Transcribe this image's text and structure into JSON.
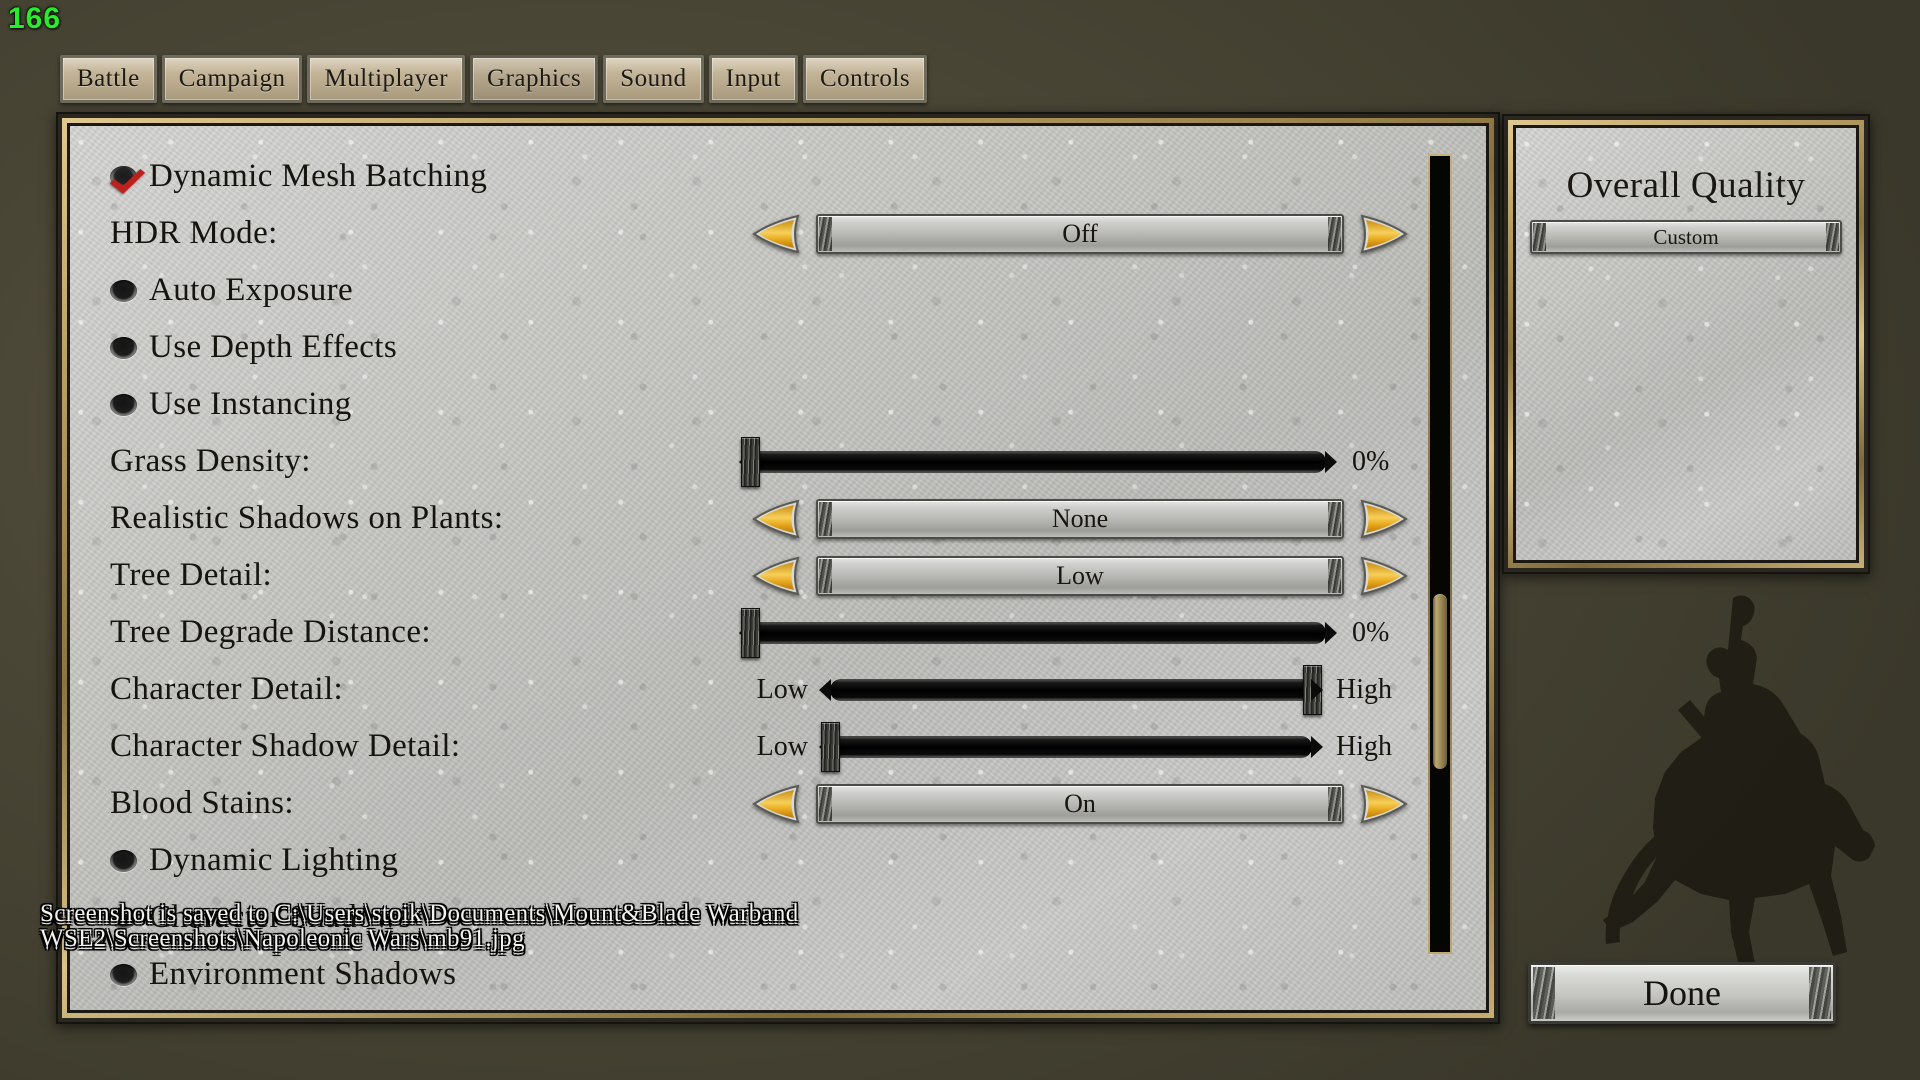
{
  "hud": {
    "fps": "166"
  },
  "tabs": [
    {
      "label": "Battle",
      "active": false
    },
    {
      "label": "Campaign",
      "active": false
    },
    {
      "label": "Multiplayer",
      "active": false
    },
    {
      "label": "Graphics",
      "active": true
    },
    {
      "label": "Sound",
      "active": false
    },
    {
      "label": "Input",
      "active": false
    },
    {
      "label": "Controls",
      "active": false
    }
  ],
  "options": [
    {
      "label": "Dynamic Mesh Batching",
      "type": "checkbox",
      "state": "checked"
    },
    {
      "label": "HDR Mode:",
      "type": "selector",
      "value": "Off"
    },
    {
      "label": "Auto Exposure",
      "type": "checkbox",
      "state": "dot"
    },
    {
      "label": "Use Depth Effects",
      "type": "checkbox",
      "state": "dot"
    },
    {
      "label": "Use Instancing",
      "type": "checkbox",
      "state": "dot"
    },
    {
      "label": "Grass Density:",
      "type": "slider",
      "percent": "0%",
      "fill": 0
    },
    {
      "label": "Realistic Shadows on Plants:",
      "type": "selector",
      "value": "None"
    },
    {
      "label": "Tree Detail:",
      "type": "selector",
      "value": "Low"
    },
    {
      "label": "Tree Degrade Distance:",
      "type": "slider",
      "percent": "0%",
      "fill": 0
    },
    {
      "label": "Character Detail:",
      "type": "range",
      "min": "Low",
      "max": "High",
      "fill": 100
    },
    {
      "label": "Character Shadow Detail:",
      "type": "range",
      "min": "Low",
      "max": "High",
      "fill": 0
    },
    {
      "label": "Blood Stains:",
      "type": "selector",
      "value": "On"
    },
    {
      "label": "Dynamic Lighting",
      "type": "checkbox",
      "state": "dot"
    },
    {
      "label": "Character Shadows",
      "type": "checkbox",
      "state": "dot"
    },
    {
      "label": "Environment Shadows",
      "type": "checkbox",
      "state": "dot"
    }
  ],
  "scrollbar": {
    "thumb_top_pct": 55,
    "thumb_height_pct": 22
  },
  "sidebar": {
    "title": "Overall Quality",
    "quality_value": "Custom"
  },
  "footer": {
    "done_label": "Done"
  },
  "toast": {
    "line1": "Screenshot is saved to C:\\Users\\stoik\\Documents\\Mount&Blade Warband",
    "line2": "WSE2\\Screenshots\\Napoleonic Wars\\mb91.jpg",
    "dup_line1": "Screenshot is saved to C:\\Users\\stoik\\Documents\\Mount&Blade Warband",
    "dup_line2": "WSE2\\Screenshots\\Napoleonic Wars\\mb91.jpg"
  },
  "colors": {
    "fps_green": "#2bec2b",
    "arrow_gold": "#f0b429",
    "frame_gold": "#b79f62",
    "stone": "#c2c2c0",
    "check_red": "#c0201c"
  }
}
